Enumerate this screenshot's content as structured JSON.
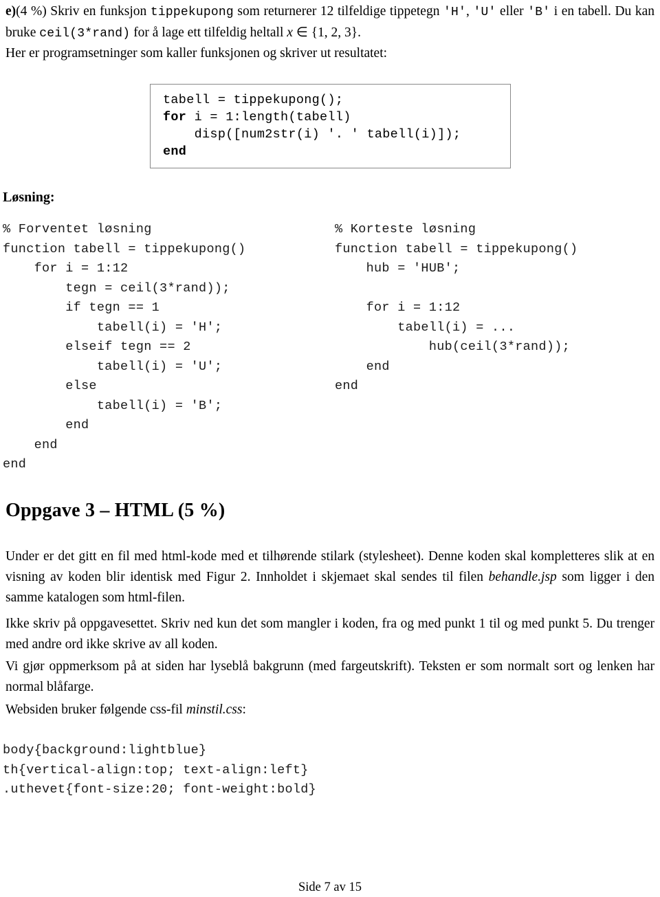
{
  "question_e": {
    "label": "e)",
    "points": "(4 %)",
    "text_1": " Skriv en funksjon ",
    "code_1": "tippekupong",
    "text_2": " som returnerer 12 tilfeldige tippetegn ",
    "code_h": "'H'",
    "sep_1": ", ",
    "code_u": "'U'",
    "text_3": " eller ",
    "code_b": "'B'",
    "text_4": " i en tabell. Du kan bruke ",
    "code_2": "ceil(3*rand)",
    "text_5": " for å lage ett tilfeldig heltall ",
    "math_var": "x",
    "math_in": " ∈ ",
    "math_set": "{1, 2, 3}",
    "text_6": "."
  },
  "intro_line": "Her er programsetninger som kaller funksjonen og skriver ut resultatet:",
  "code_box": {
    "line_1": "tabell = tippekupong();",
    "line_2_keyword": "for",
    "line_2_rest": " i = 1:length(tabell)",
    "line_3": "    disp([num2str(i) '. ' tabell(i)]);",
    "line_4_keyword": "end"
  },
  "losning_heading": "Løsning:",
  "solution_left": "% Forventet løsning\nfunction tabell = tippekupong()\n    for i = 1:12\n        tegn = ceil(3*rand));\n        if tegn == 1\n            tabell(i) = 'H';\n        elseif tegn == 2\n            tabell(i) = 'U';\n        else\n            tabell(i) = 'B';\n        end\n    end\nend",
  "solution_right": "% Korteste løsning\nfunction tabell = tippekupong()\n    hub = 'HUB';\n\n    for i = 1:12\n        tabell(i) = ...\n            hub(ceil(3*rand));\n    end\nend",
  "oppgave3_heading": "Oppgave 3 – HTML (5 %)",
  "paragraphs": {
    "p1_a": "Under er det gitt en fil med html-kode med et tilhørende stilark (stylesheet). Denne koden skal kompletteres slik at en visning av koden blir identisk med Figur 2. Innholdet i skjemaet skal sendes til filen ",
    "p1_italic": "behandle.jsp",
    "p1_b": " som ligger i den samme katalogen som html-filen.",
    "p2": "Ikke skriv på oppgavesettet. Skriv ned kun det som mangler i koden, fra og med punkt 1 til og med punkt 5. Du trenger med andre ord ikke skrive av all koden.",
    "p3": "Vi gjør oppmerksom på at siden har lyseblå bakgrunn (med fargeutskrift). Teksten er som normalt sort og lenken har normal blåfarge.",
    "p4_a": "Websiden bruker følgende css-fil ",
    "p4_italic": "minstil.css",
    "p4_b": ":"
  },
  "css_listing": "body{background:lightblue}\nth{vertical-align:top; text-align:left}\n.uthevet{font-size:20; font-weight:bold}",
  "footer": "Side 7 av 15"
}
